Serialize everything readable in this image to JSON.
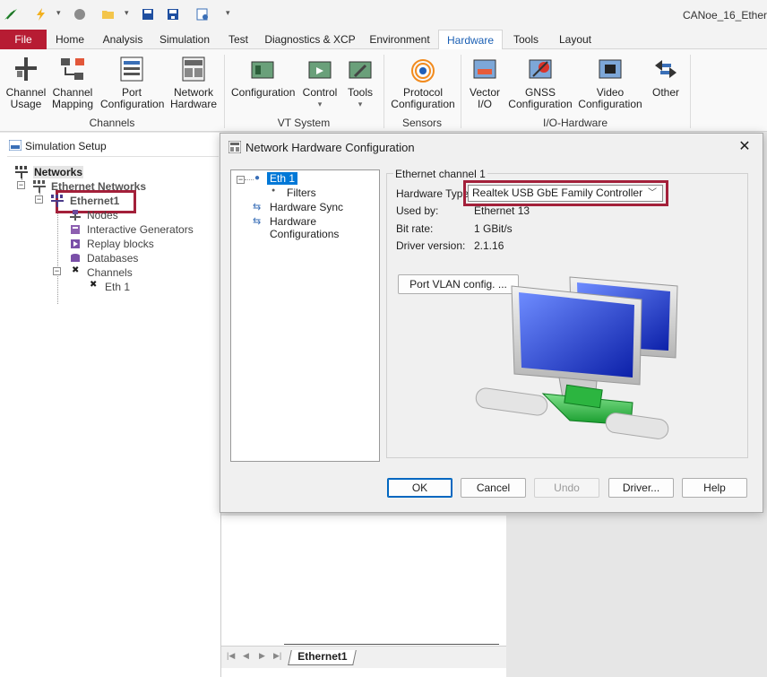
{
  "app_title": "CANoe_16_Ether",
  "file_tab": "File",
  "tabs": [
    "Home",
    "Analysis",
    "Simulation",
    "Test",
    "Diagnostics & XCP",
    "Environment",
    "Hardware",
    "Tools",
    "Layout"
  ],
  "ribbon": {
    "channels": {
      "label": "Channels",
      "items": [
        {
          "l1": "Channel",
          "l2": "Usage"
        },
        {
          "l1": "Channel",
          "l2": "Mapping"
        },
        {
          "l1": "Port",
          "l2": "Configuration"
        },
        {
          "l1": "Network",
          "l2": "Hardware"
        }
      ]
    },
    "vt": {
      "label": "VT System",
      "items": [
        {
          "l1": "Configuration"
        },
        {
          "l1": "Control",
          "arrow": "▾"
        },
        {
          "l1": "Tools",
          "arrow": "▾"
        }
      ]
    },
    "sensors": {
      "label": "Sensors",
      "items": [
        {
          "l1": "Protocol",
          "l2": "Configuration"
        }
      ]
    },
    "io": {
      "label": "I/O-Hardware",
      "items": [
        {
          "l1": "Vector",
          "l2": "I/O"
        },
        {
          "l1": "GNSS",
          "l2": "Configuration"
        },
        {
          "l1": "Video",
          "l2": "Configuration"
        },
        {
          "l1": "Other"
        }
      ]
    }
  },
  "sim": {
    "title": "Simulation Setup",
    "tree": {
      "networks": "Networks",
      "ethernet_networks": "Ethernet Networks",
      "ethernet1": "Ethernet1",
      "nodes": "Nodes",
      "interactive": "Interactive Generators",
      "replay": "Replay blocks",
      "databases": "Databases",
      "channels": "Channels",
      "eth1": "Eth 1"
    },
    "tab": "Ethernet1"
  },
  "dialog": {
    "title": "Network Hardware Configuration",
    "close": "✕",
    "tree": {
      "eth1": "Eth 1",
      "filters": "Filters",
      "sync": "Hardware Sync",
      "configs": "Hardware Configurations"
    },
    "frame_label": "Ethernet channel 1",
    "hw_type_label": "Hardware Type:",
    "hw_type_value": "Realtek USB GbE Family Controller",
    "used_by_label": "Used by:",
    "used_by_value": "Ethernet 13",
    "bit_rate_label": "Bit rate:",
    "bit_rate_value": "1 GBit/s",
    "driver_label": "Driver version:",
    "driver_value": "2.1.16",
    "vlan_button": "Port VLAN config. ...",
    "buttons": {
      "ok": "OK",
      "cancel": "Cancel",
      "undo": "Undo",
      "driver": "Driver...",
      "help": "Help"
    }
  },
  "colors": {
    "file_tab": "#b71c33",
    "highlight": "#a3203a",
    "accent": "#0067c0",
    "selection": "#0078d7"
  }
}
